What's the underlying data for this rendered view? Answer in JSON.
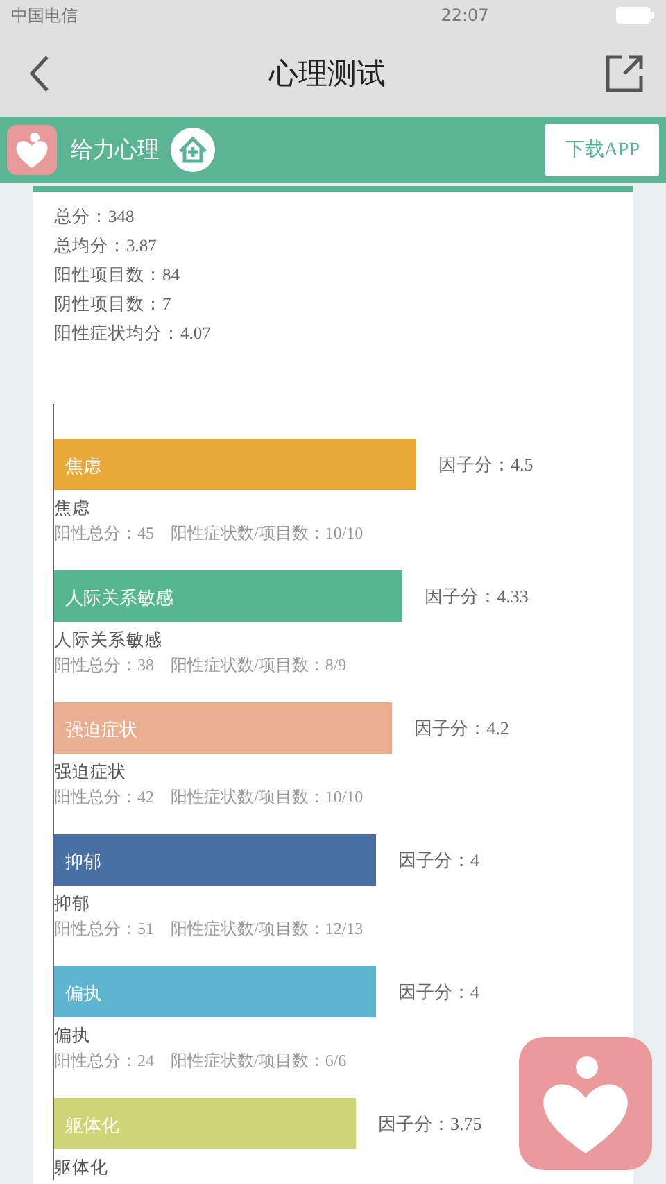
{
  "status_bar": {
    "carrier": "中国电信",
    "time": "22:07"
  },
  "nav": {
    "title": "心理测试"
  },
  "banner": {
    "brand": "给力心理",
    "download": "下载APP"
  },
  "summary": [
    {
      "text": "总分：348"
    },
    {
      "text": "总均分：3.87"
    },
    {
      "text": "阳性项目数：84"
    },
    {
      "text": "阴性项目数：7"
    },
    {
      "text": "阳性症状均分：4.07"
    }
  ],
  "chart": {
    "chart_data": {
      "type": "bar",
      "orientation": "horizontal",
      "categories": [
        "焦虑",
        "人际关系敏感",
        "强迫症状",
        "抑郁",
        "偏执",
        "躯体化"
      ],
      "values": [
        4.5,
        4.33,
        4.2,
        4,
        4,
        3.75
      ],
      "value_labels": [
        "因子分：4.5",
        "因子分：4.33",
        "因子分：4.2",
        "因子分：4",
        "因子分：4",
        "因子分：3.75"
      ]
    }
  },
  "factors": [
    {
      "color": "#e9a936",
      "title": "焦虑",
      "detail": "阳性总分：45　阳性症状数/项目数：10/10"
    },
    {
      "color": "#56b68e",
      "title": "人际关系敏感",
      "detail": "阳性总分：38　阳性症状数/项目数：8/9"
    },
    {
      "color": "#e8ae8f",
      "title": "强迫症状",
      "detail": "阳性总分：42　阳性症状数/项目数：10/10"
    },
    {
      "color": "#4870a3",
      "title": "抑郁",
      "detail": "阳性总分：51　阳性症状数/项目数：12/13"
    },
    {
      "color": "#5db5cf",
      "title": "偏执",
      "detail": "阳性总分：24　阳性症状数/项目数：6/6"
    },
    {
      "color": "#cfd474",
      "title": "躯体化"
    }
  ]
}
